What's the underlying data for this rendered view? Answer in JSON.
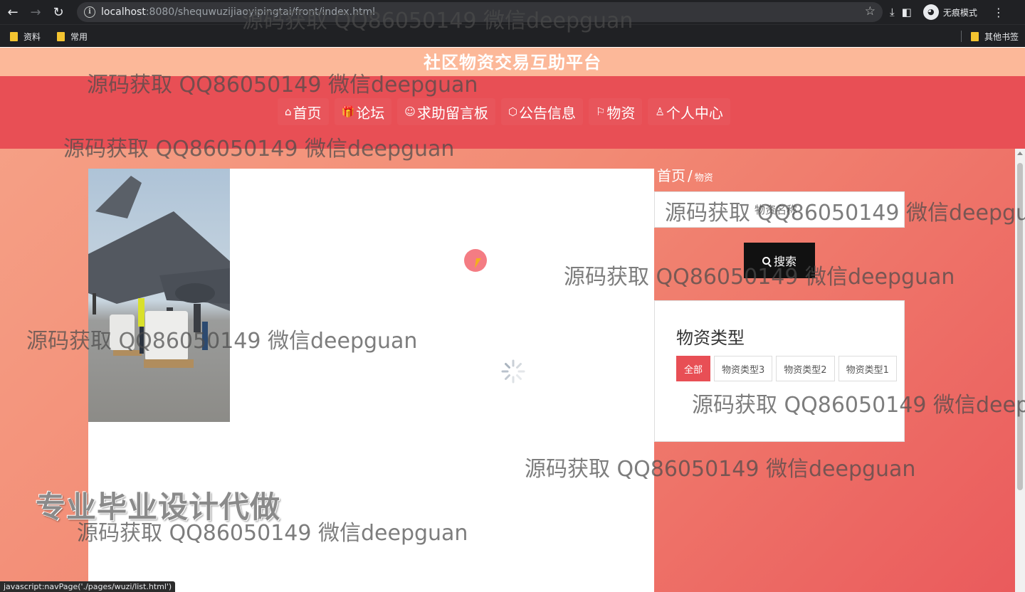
{
  "browser": {
    "url_host": "localhost",
    "url_path": ":8080/shequwuzijiaoyipingtai/front/index.html",
    "incognito_label": "无痕模式",
    "bookmarks": [
      "资料",
      "常用"
    ],
    "other_bookmarks": "其他书签"
  },
  "site": {
    "title": "社区物资交易互助平台"
  },
  "nav": {
    "items": [
      {
        "icon": "⌂",
        "label": "首页"
      },
      {
        "icon": "🎁",
        "label": "论坛"
      },
      {
        "icon": "☺",
        "label": "求助留言板"
      },
      {
        "icon": "⬡",
        "label": "公告信息"
      },
      {
        "icon": "⚐",
        "label": "物资"
      },
      {
        "icon": "♙",
        "label": "个人中心"
      }
    ],
    "active_index": 4
  },
  "breadcrumb": {
    "home": "首页",
    "separator": "/",
    "current": "物资"
  },
  "search": {
    "placeholder": "物资名称",
    "button_label": "搜索"
  },
  "category": {
    "title": "物资类型",
    "tags": [
      "全部",
      "物资类型3",
      "物资类型2",
      "物资类型1"
    ],
    "active_index": 0
  },
  "watermarks": {
    "text": "源码获取 QQ86050149 微信deepguan",
    "promo": "专业毕业设计代做"
  },
  "status_bar": "javascript:navPage('./pages/wuzi/list.html')",
  "colors": {
    "nav_bg": "#e84f55",
    "title_bar_bg": "#fcb899",
    "active_nav_bg": "#f9b193",
    "search_button_bg": "#111111"
  }
}
